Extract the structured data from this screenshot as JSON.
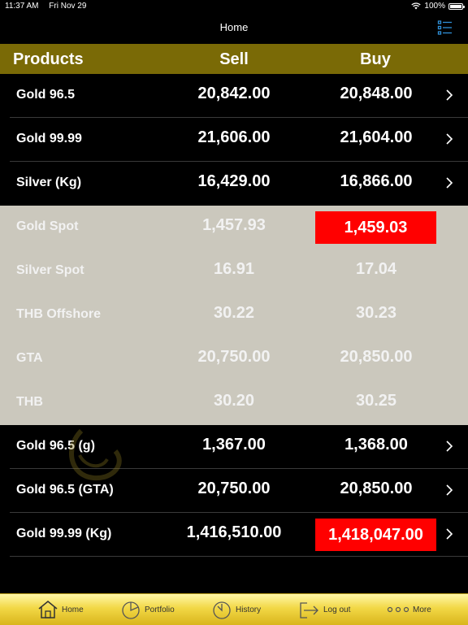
{
  "status": {
    "time": "11:37 AM",
    "date": "Fri Nov 29",
    "battery": "100%"
  },
  "nav": {
    "title": "Home"
  },
  "table": {
    "headers": {
      "products": "Products",
      "sell": "Sell",
      "buy": "Buy"
    },
    "rows": [
      {
        "name": "Gold 96.5",
        "sell": "20,842.00",
        "buy": "20,848.00"
      },
      {
        "name": "Gold 99.99",
        "sell": "21,606.00",
        "buy": "21,604.00"
      },
      {
        "name": "Silver (Kg)",
        "sell": "16,429.00",
        "buy": "16,866.00"
      },
      {
        "name": "Gold Spot",
        "sell": "1,457.93",
        "buy": "1,459.03"
      },
      {
        "name": "Silver Spot",
        "sell": "16.91",
        "buy": "17.04"
      },
      {
        "name": "THB Offshore",
        "sell": "30.22",
        "buy": "30.23"
      },
      {
        "name": "GTA",
        "sell": "20,750.00",
        "buy": "20,850.00"
      },
      {
        "name": "THB",
        "sell": "30.20",
        "buy": "30.25"
      },
      {
        "name": "Gold 96.5 (g)",
        "sell": "1,367.00",
        "buy": "1,368.00"
      },
      {
        "name": "Gold 96.5 (GTA)",
        "sell": "20,750.00",
        "buy": "20,850.00"
      },
      {
        "name": "Gold 99.99 (Kg)",
        "sell": "1,416,510.00",
        "buy": "1,418,047.00"
      }
    ]
  },
  "tabs": {
    "home": "Home",
    "portfolio": "Portfolio",
    "history": "History",
    "logout": "Log out",
    "more": "More"
  },
  "colors": {
    "header_bg": "#7a6a06",
    "spot_bg": "#cbc8bd",
    "highlight_red": "#ff0000",
    "tab_bar_gold": "#f2d846",
    "accent_blue": "#2f8fd8"
  }
}
